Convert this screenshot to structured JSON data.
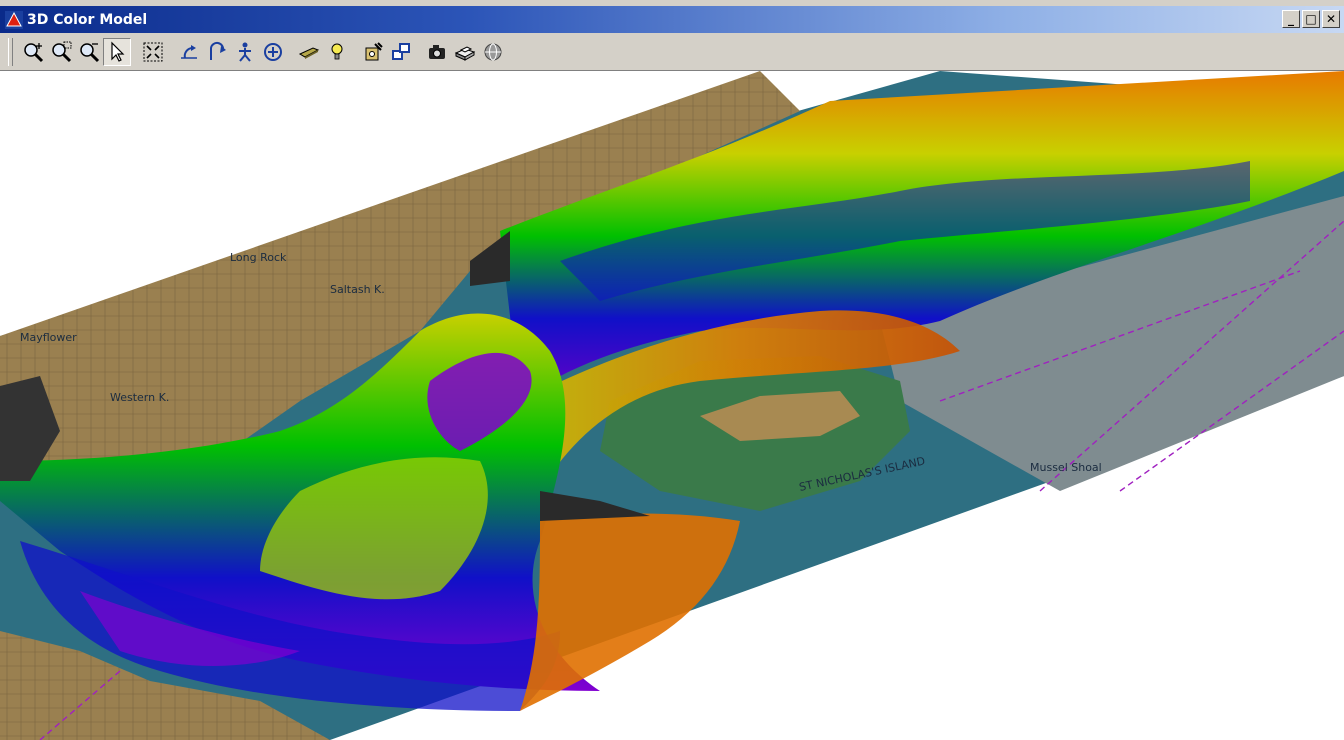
{
  "window": {
    "title": "3D Color Model",
    "controls": [
      "_",
      "□",
      "✕"
    ]
  },
  "toolbar": {
    "buttons": [
      {
        "name": "zoom-in",
        "icon": "zoom-in-icon",
        "active": false
      },
      {
        "name": "zoom-window",
        "icon": "zoom-window-icon",
        "active": false
      },
      {
        "name": "zoom-out",
        "icon": "zoom-out-icon",
        "active": false
      },
      {
        "name": "select",
        "icon": "pointer-icon",
        "active": true
      },
      {
        "name": "zoom-extents",
        "icon": "zoom-extents-icon",
        "active": false
      },
      {
        "name": "rotate",
        "icon": "rotate-icon",
        "active": false
      },
      {
        "name": "tilt",
        "icon": "tilt-icon",
        "active": false
      },
      {
        "name": "walk",
        "icon": "walk-icon",
        "active": false
      },
      {
        "name": "pan",
        "icon": "pan-icon",
        "active": false
      },
      {
        "name": "surface",
        "icon": "surface-icon",
        "active": false
      },
      {
        "name": "light",
        "icon": "light-bulb-icon",
        "active": false
      },
      {
        "name": "settings",
        "icon": "settings-icon",
        "active": false
      },
      {
        "name": "window-layout",
        "icon": "window-layout-icon",
        "active": false
      },
      {
        "name": "capture",
        "icon": "camera-icon",
        "active": false
      },
      {
        "name": "print",
        "icon": "printer-icon",
        "active": false
      },
      {
        "name": "globe",
        "icon": "globe-icon",
        "active": false
      }
    ]
  },
  "view": {
    "description_colors": {
      "land": "#9a8050",
      "shallow_water": "#2e6f82",
      "deep_water": "#7f8c90",
      "chart_lines": "#a020c0",
      "ramp": [
        "#6a00c8",
        "#1010c8",
        "#00c000",
        "#c8d000",
        "#e88000",
        "#d03000"
      ]
    },
    "chart_labels": [
      "Long Rock",
      "Western K.",
      "Saltash K.",
      "ST NICHOLAS'S ISLAND",
      "Mussel Shoal",
      "Mayflower"
    ]
  }
}
